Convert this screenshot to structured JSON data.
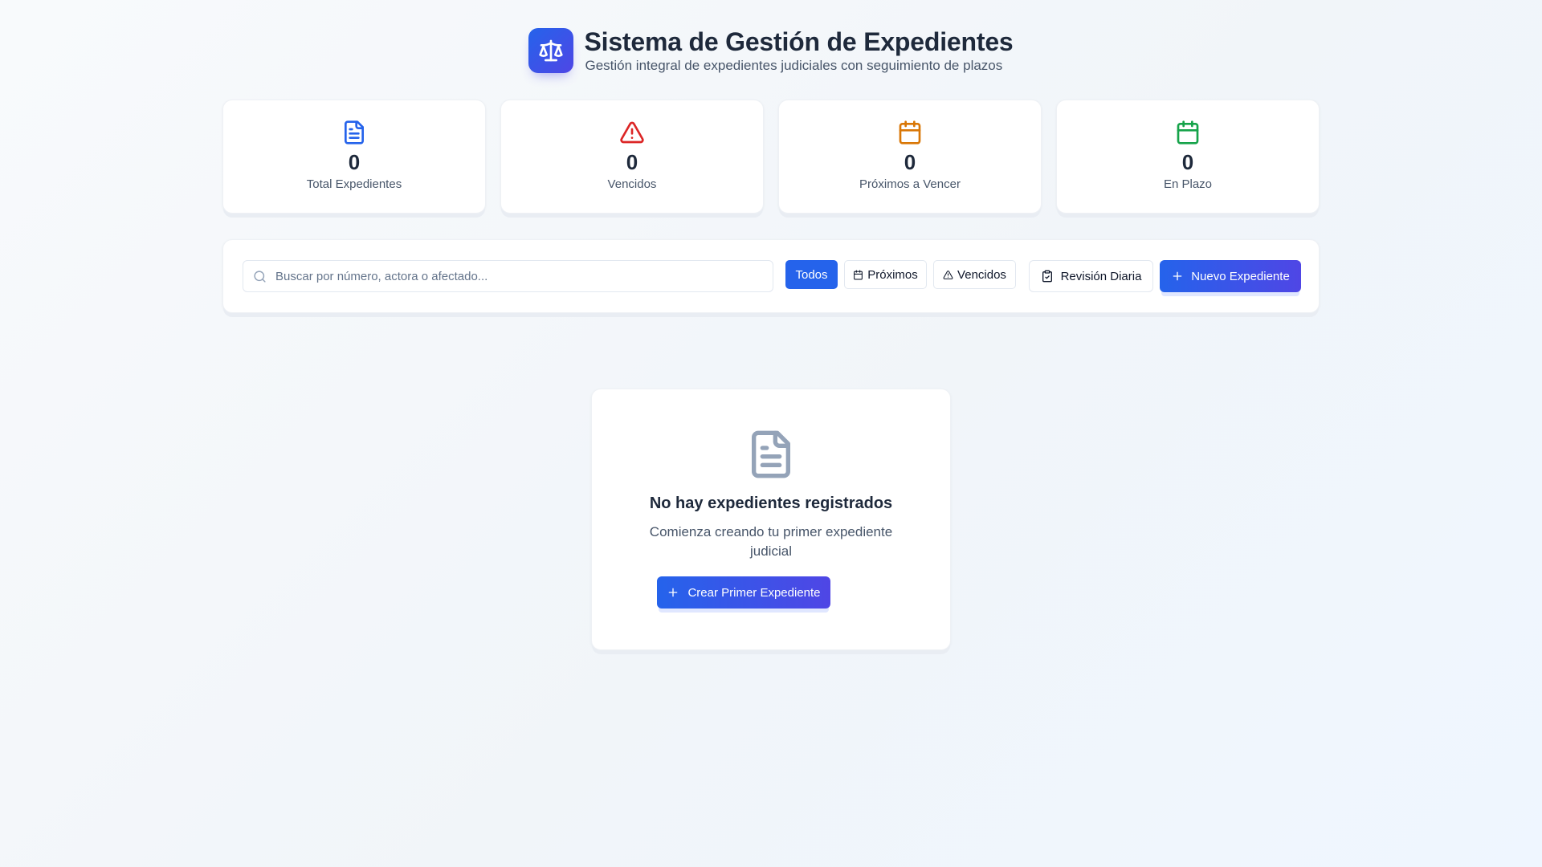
{
  "header": {
    "logo_icon": "scale-icon",
    "title": "Sistema de Gestión de Expedientes",
    "subtitle": "Gestión integral de expedientes judiciales con seguimiento de plazos"
  },
  "stats": [
    {
      "icon": "file-text-icon",
      "color": "#2563eb",
      "value": "0",
      "label": "Total Expedientes"
    },
    {
      "icon": "alert-triangle-icon",
      "color": "#dc2626",
      "value": "0",
      "label": "Vencidos"
    },
    {
      "icon": "calendar-icon",
      "color": "#d97706",
      "value": "0",
      "label": "Próximos a Vencer"
    },
    {
      "icon": "calendar-icon",
      "color": "#16a34a",
      "value": "0",
      "label": "En Plazo"
    }
  ],
  "toolbar": {
    "search_placeholder": "Buscar por número, actora o afectado...",
    "search_value": "",
    "filters": [
      {
        "label": "Todos",
        "active": true
      },
      {
        "label": "Próximos",
        "icon": "calendar-icon",
        "active": false
      },
      {
        "label": "Vencidos",
        "icon": "alert-triangle-icon",
        "active": false
      }
    ],
    "revision_label": "Revisión Diaria",
    "nuevo_label": "Nuevo Expediente"
  },
  "empty_state": {
    "icon": "file-text-icon",
    "title": "No hay expedientes registrados",
    "description": "Comienza creando tu primer expediente judicial",
    "button_label": "Crear Primer Expediente"
  },
  "colors": {
    "primary": "#2563eb",
    "primary_end": "#4f46e5",
    "danger": "#dc2626",
    "warning": "#d97706",
    "success": "#16a34a",
    "muted_icon": "#94a3b8"
  }
}
